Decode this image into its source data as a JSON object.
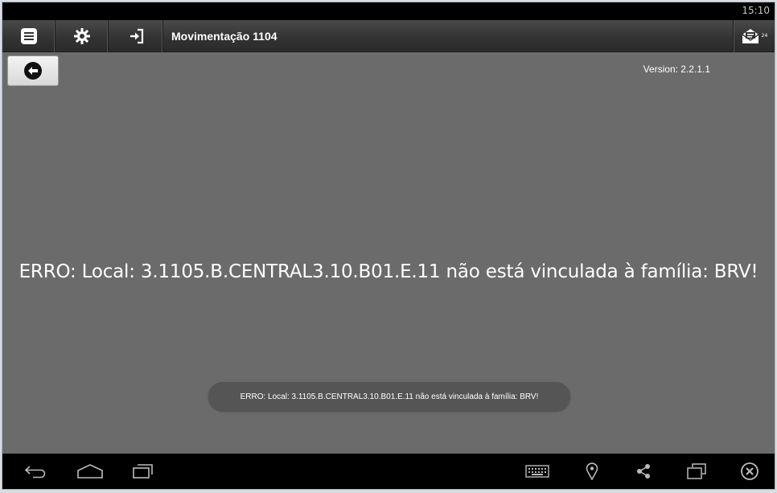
{
  "status_bar": {
    "time": "15:10"
  },
  "action_bar": {
    "menu_icon": "list-icon",
    "settings_icon": "gear-icon",
    "login_icon": "sign-in-icon",
    "title": "Movimentação 1104",
    "mail_icon": "envelope-icon",
    "mail_count": "24"
  },
  "content": {
    "back_icon": "arrow-left-icon",
    "version": "Version: 2.2.1.1",
    "error_message": "ERRO: Local: 3.1105.B.CENTRAL3.10.B01.E.11 não está vinculada à família: BRV!"
  },
  "toast": {
    "message": "ERRO: Local: 3.1105.B.CENTRAL3.10.B01.E.11 não está vinculada à família: BRV!"
  },
  "nav_bar": {
    "icons": [
      "back-icon",
      "home-icon",
      "recents-icon",
      "keyboard-icon",
      "location-icon",
      "share-icon",
      "window-icon",
      "close-icon"
    ]
  },
  "colors": {
    "background": "#6b6b6b",
    "action_bar": "#333333",
    "system_bar": "#000000",
    "toast": "#555555"
  }
}
